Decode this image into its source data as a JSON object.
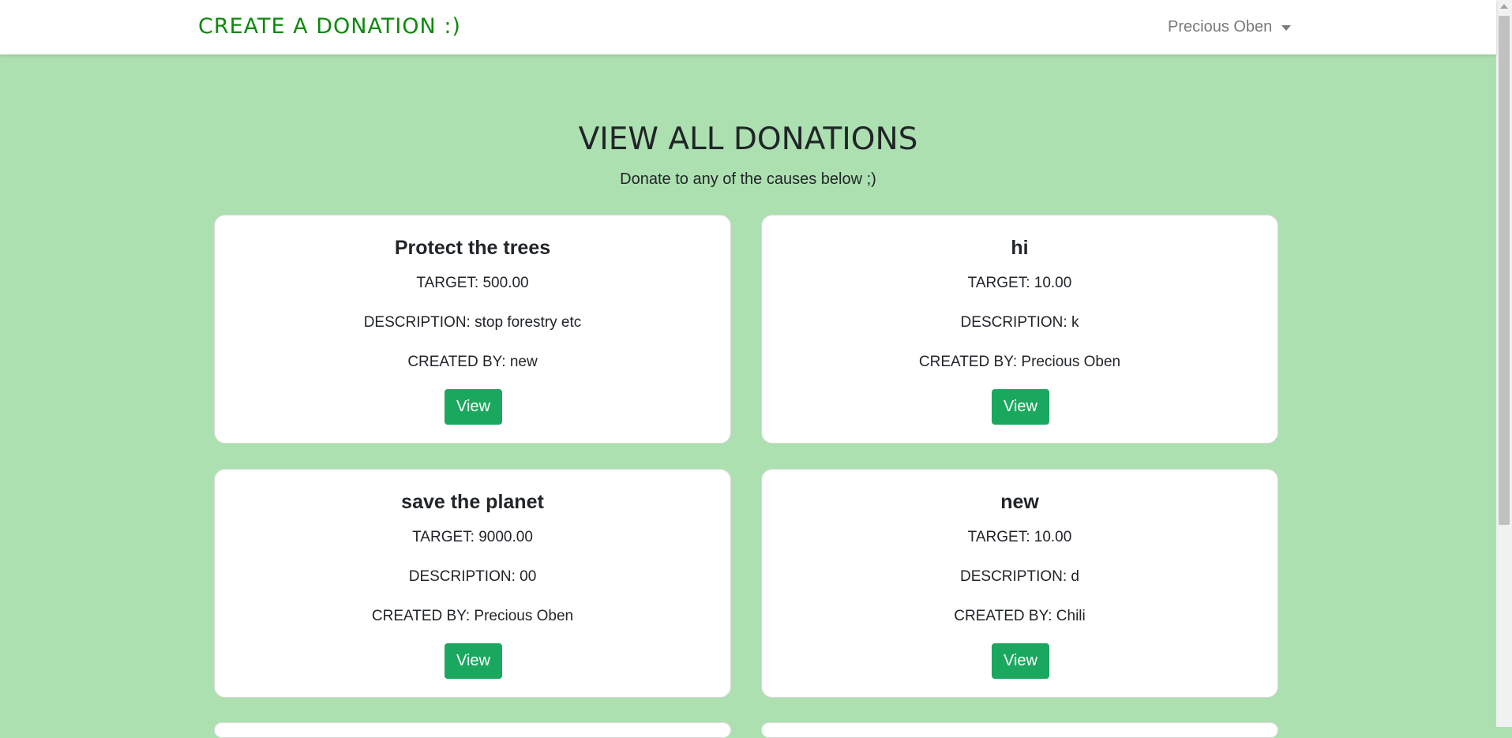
{
  "navbar": {
    "brand": "CREATE A DONATION :)",
    "user_name": "Precious Oben"
  },
  "header": {
    "title": "VIEW ALL DONATIONS",
    "subtitle": "Donate to any of the causes below ;)"
  },
  "donations": [
    {
      "title": "Protect the trees",
      "target": "TARGET: 500.00",
      "description": "DESCRIPTION: stop forestry etc",
      "created_by": "CREATED BY: new",
      "button": "View"
    },
    {
      "title": "hi",
      "target": "TARGET: 10.00",
      "description": "DESCRIPTION: k",
      "created_by": "CREATED BY: Precious Oben",
      "button": "View"
    },
    {
      "title": "save the planet",
      "target": "TARGET: 9000.00",
      "description": "DESCRIPTION: 00",
      "created_by": "CREATED BY: Precious Oben",
      "button": "View"
    },
    {
      "title": "new",
      "target": "TARGET: 10.00",
      "description": "DESCRIPTION: d",
      "created_by": "CREATED BY: Chili",
      "button": "View"
    }
  ],
  "colors": {
    "background": "#ade0b0",
    "brand": "#0b8a0b",
    "button": "#1aa85f"
  }
}
